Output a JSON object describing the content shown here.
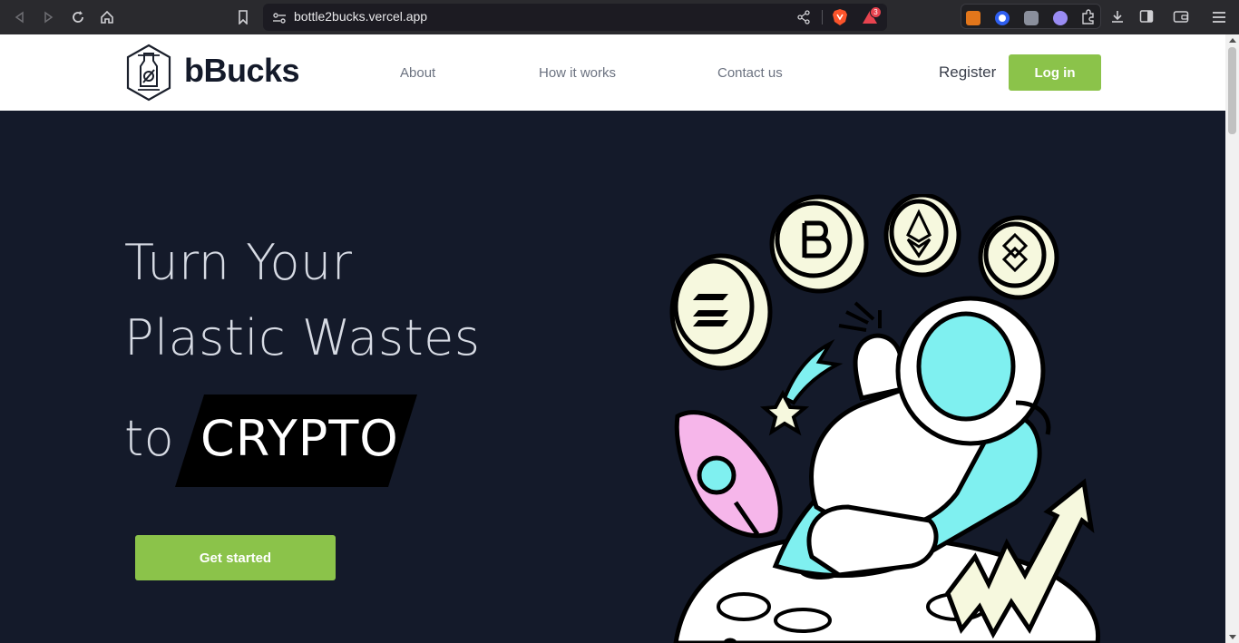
{
  "browser": {
    "url": "bottle2bucks.vercel.app",
    "brave_badge": "3"
  },
  "header": {
    "logo_text": "bBucks",
    "nav": [
      "About",
      "How it works",
      "Contact us"
    ],
    "register": "Register",
    "login": "Log in"
  },
  "hero": {
    "line1": "Turn Your",
    "line2": "Plastic Wastes",
    "line3_prefix": "to",
    "highlight": "CRYPTO",
    "cta": "Get started"
  },
  "colors": {
    "hero_bg": "#141a2a",
    "accent_green": "#8bc34a",
    "illustration_cyan": "#7ff0f0",
    "illustration_pink": "#f6b6ea",
    "coin_cream": "#f6f8de"
  }
}
